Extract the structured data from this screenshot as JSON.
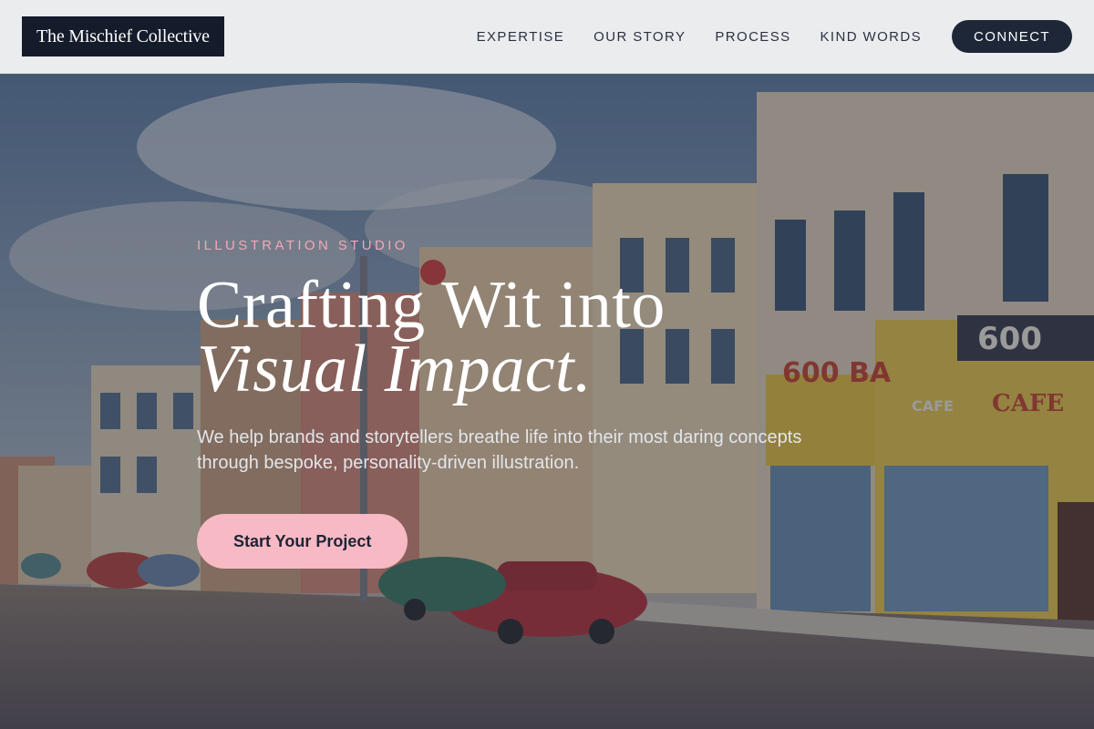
{
  "header": {
    "logo": "The Mischief Collective",
    "nav": [
      {
        "label": "EXPERTISE"
      },
      {
        "label": "OUR STORY"
      },
      {
        "label": "PROCESS"
      },
      {
        "label": "KIND WORDS"
      }
    ],
    "cta_label": "CONNECT"
  },
  "hero": {
    "eyebrow": "ILLUSTRATION STUDIO",
    "headline_line1": "Crafting Wit into",
    "headline_line2": "Visual Impact.",
    "subcopy": "We help brands and storytellers breathe life into their most daring concepts through bespoke, personality-driven illustration.",
    "cta_label": "Start Your Project",
    "background_signs": [
      "600",
      "600 BA",
      "CAFE",
      "CAFE"
    ]
  },
  "colors": {
    "header_bg": "#ebecee",
    "logo_bg": "#141b2b",
    "connect_bg": "#1d2738",
    "accent_pink": "#f7b9c4",
    "eyebrow_pink": "#f2a8b6"
  }
}
